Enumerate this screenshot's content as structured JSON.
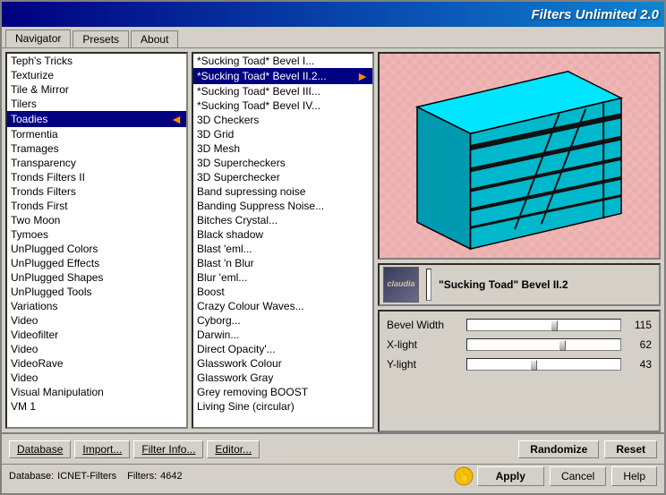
{
  "titleBar": {
    "title": "Filters Unlimited 2.0"
  },
  "tabs": [
    {
      "label": "Navigator",
      "active": true
    },
    {
      "label": "Presets",
      "active": false
    },
    {
      "label": "About",
      "active": false
    }
  ],
  "leftList": {
    "items": [
      "Teph's Tricks",
      "Texturize",
      "Tile & Mirror",
      "Tilers",
      "Toadies",
      "Tormentia",
      "Tramages",
      "Transparency",
      "Tronds Filters II",
      "Tronds Filters",
      "Tronds First",
      "Two Moon",
      "Tymoes",
      "UnPlugged Colors",
      "UnPlugged Effects",
      "UnPlugged Shapes",
      "UnPlugged Tools",
      "Variations",
      "Video",
      "Videofilter",
      "Video",
      "VideoRave",
      "Video",
      "Visual Manipulation",
      "VM 1"
    ],
    "selectedIndex": 4
  },
  "rightList": {
    "items": [
      "*Sucking Toad*  Bevel I...",
      "*Sucking Toad*  Bevel II.2...",
      "*Sucking Toad*  Bevel III...",
      "*Sucking Toad*  Bevel IV...",
      "3D Checkers",
      "3D Grid",
      "3D Mesh",
      "3D Supercheckers",
      "3D Superchecker",
      "Band supressing noise",
      "Banding Suppress Noise...",
      "Bitches Crystal...",
      "Black shadow",
      "Blast 'eml...",
      "Blast 'n Blur",
      "Blur 'eml...",
      "Boost",
      "Crazy Colour Waves...",
      "Cyborg...",
      "Darwin...",
      "Direct Opacity'...",
      "Glasswork Colour",
      "Glasswork Gray",
      "Grey removing BOOST",
      "Living Sine (circular)"
    ],
    "selectedIndex": 1
  },
  "filterInfo": {
    "name": "\"Sucking Toad\" Bevel II.2",
    "thumbnail": "claudia"
  },
  "sliders": [
    {
      "label": "Bevel Width",
      "value": 115,
      "max": 200,
      "percent": 57
    },
    {
      "label": "X-light",
      "value": 62,
      "max": 100,
      "percent": 62
    },
    {
      "label": "Y-light",
      "value": 43,
      "max": 100,
      "percent": 43
    }
  ],
  "toolbar": {
    "database": "Database",
    "import": "Import...",
    "filterInfo": "Filter Info...",
    "editor": "Editor...",
    "randomize": "Randomize",
    "reset": "Reset"
  },
  "statusBar": {
    "label1": "Database:",
    "value1": "ICNET-Filters",
    "label2": "Filters:",
    "value2": "4642"
  },
  "actionButtons": {
    "apply": "Apply",
    "cancel": "Cancel",
    "help": "Help"
  }
}
